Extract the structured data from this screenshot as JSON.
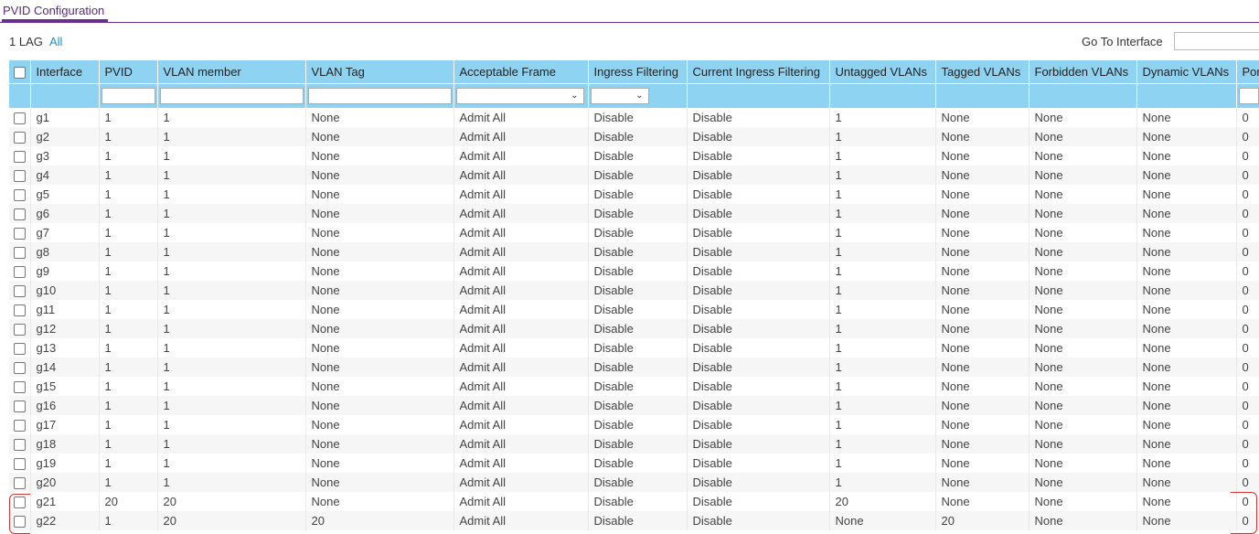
{
  "header": {
    "tab_label": "PVID Configuration"
  },
  "filters": {
    "lag_label": "1 LAG",
    "all_link": "All",
    "goto_label": "Go To Interface",
    "goto_value": ""
  },
  "table": {
    "columns": [
      "Interface",
      "PVID",
      "VLAN member",
      "VLAN Tag",
      "Acceptable Frame",
      "Ingress Filtering",
      "Current Ingress Filtering",
      "Untagged VLANs",
      "Tagged VLANs",
      "Forbidden VLANs",
      "Dynamic VLANs",
      "Port"
    ],
    "rows": [
      [
        "g1",
        "1",
        "1",
        "None",
        "Admit All",
        "Disable",
        "Disable",
        "1",
        "None",
        "None",
        "None",
        "0"
      ],
      [
        "g2",
        "1",
        "1",
        "None",
        "Admit All",
        "Disable",
        "Disable",
        "1",
        "None",
        "None",
        "None",
        "0"
      ],
      [
        "g3",
        "1",
        "1",
        "None",
        "Admit All",
        "Disable",
        "Disable",
        "1",
        "None",
        "None",
        "None",
        "0"
      ],
      [
        "g4",
        "1",
        "1",
        "None",
        "Admit All",
        "Disable",
        "Disable",
        "1",
        "None",
        "None",
        "None",
        "0"
      ],
      [
        "g5",
        "1",
        "1",
        "None",
        "Admit All",
        "Disable",
        "Disable",
        "1",
        "None",
        "None",
        "None",
        "0"
      ],
      [
        "g6",
        "1",
        "1",
        "None",
        "Admit All",
        "Disable",
        "Disable",
        "1",
        "None",
        "None",
        "None",
        "0"
      ],
      [
        "g7",
        "1",
        "1",
        "None",
        "Admit All",
        "Disable",
        "Disable",
        "1",
        "None",
        "None",
        "None",
        "0"
      ],
      [
        "g8",
        "1",
        "1",
        "None",
        "Admit All",
        "Disable",
        "Disable",
        "1",
        "None",
        "None",
        "None",
        "0"
      ],
      [
        "g9",
        "1",
        "1",
        "None",
        "Admit All",
        "Disable",
        "Disable",
        "1",
        "None",
        "None",
        "None",
        "0"
      ],
      [
        "g10",
        "1",
        "1",
        "None",
        "Admit All",
        "Disable",
        "Disable",
        "1",
        "None",
        "None",
        "None",
        "0"
      ],
      [
        "g11",
        "1",
        "1",
        "None",
        "Admit All",
        "Disable",
        "Disable",
        "1",
        "None",
        "None",
        "None",
        "0"
      ],
      [
        "g12",
        "1",
        "1",
        "None",
        "Admit All",
        "Disable",
        "Disable",
        "1",
        "None",
        "None",
        "None",
        "0"
      ],
      [
        "g13",
        "1",
        "1",
        "None",
        "Admit All",
        "Disable",
        "Disable",
        "1",
        "None",
        "None",
        "None",
        "0"
      ],
      [
        "g14",
        "1",
        "1",
        "None",
        "Admit All",
        "Disable",
        "Disable",
        "1",
        "None",
        "None",
        "None",
        "0"
      ],
      [
        "g15",
        "1",
        "1",
        "None",
        "Admit All",
        "Disable",
        "Disable",
        "1",
        "None",
        "None",
        "None",
        "0"
      ],
      [
        "g16",
        "1",
        "1",
        "None",
        "Admit All",
        "Disable",
        "Disable",
        "1",
        "None",
        "None",
        "None",
        "0"
      ],
      [
        "g17",
        "1",
        "1",
        "None",
        "Admit All",
        "Disable",
        "Disable",
        "1",
        "None",
        "None",
        "None",
        "0"
      ],
      [
        "g18",
        "1",
        "1",
        "None",
        "Admit All",
        "Disable",
        "Disable",
        "1",
        "None",
        "None",
        "None",
        "0"
      ],
      [
        "g19",
        "1",
        "1",
        "None",
        "Admit All",
        "Disable",
        "Disable",
        "1",
        "None",
        "None",
        "None",
        "0"
      ],
      [
        "g20",
        "1",
        "1",
        "None",
        "Admit All",
        "Disable",
        "Disable",
        "1",
        "None",
        "None",
        "None",
        "0"
      ],
      [
        "g21",
        "20",
        "20",
        "None",
        "Admit All",
        "Disable",
        "Disable",
        "20",
        "None",
        "None",
        "None",
        "0"
      ],
      [
        "g22",
        "1",
        "20",
        "20",
        "Admit All",
        "Disable",
        "Disable",
        "None",
        "20",
        "None",
        "None",
        "0"
      ]
    ]
  },
  "colors": {
    "accent": "#6b2d8f",
    "header_bg": "#8fd3f2",
    "link": "#1a8fd6",
    "annotation": "#dd3333"
  }
}
